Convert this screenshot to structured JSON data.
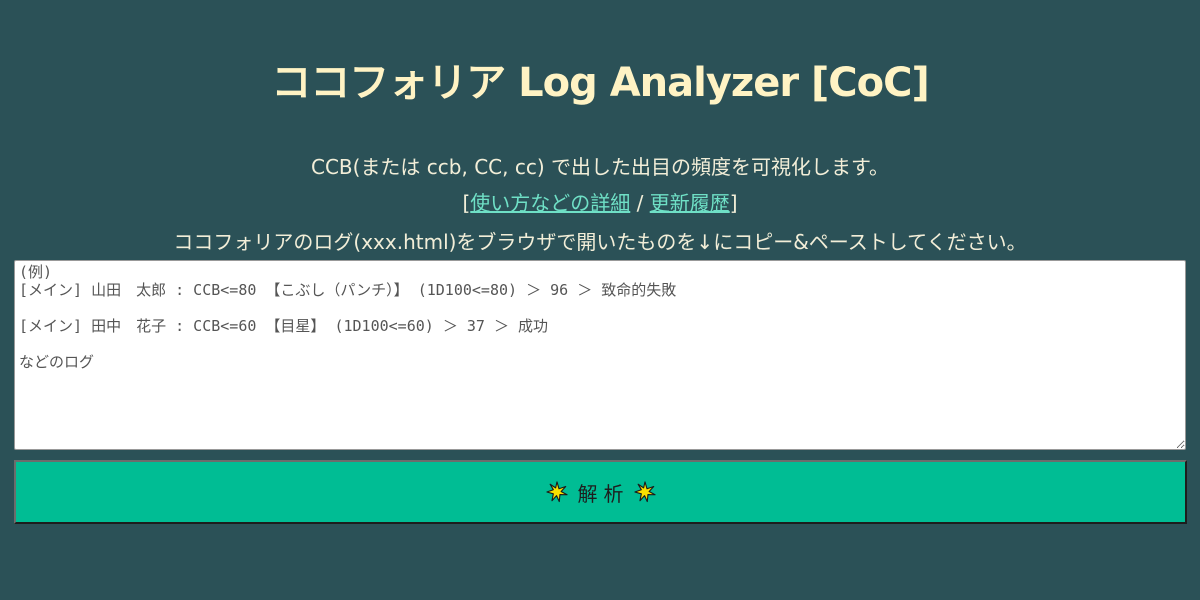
{
  "header": {
    "title": "ココフォリア Log Analyzer [CoC]"
  },
  "intro": {
    "line1": "CCB(または ccb, CC, cc) で出した出目の頻度を可視化します。",
    "bracket_open": "[",
    "link_usage": "使い方などの詳細",
    "separator": " / ",
    "link_history": "更新履歴",
    "bracket_close": "]",
    "line3": "ココフォリアのログ(xxx.html)をブラウザで開いたものを↓にコピー&ペーストしてください。"
  },
  "log_input": {
    "value": "",
    "placeholder": "(例)\n[メイン] 山田　太郎 : CCB<=80 【こぶし（パンチ）】 (1D100<=80) ＞ 96 ＞ 致命的失敗\n\n[メイン] 田中　花子 : CCB<=60 【目星】 (1D100<=60) ＞ 37 ＞ 成功\n\nなどのログ"
  },
  "analyze_button": {
    "label": "解析",
    "icon": "sparkle-icon"
  },
  "colors": {
    "background": "#2b5157",
    "title": "#fff3c4",
    "text": "#f2eed8",
    "link": "#6fe0c6",
    "button": "#00bd94"
  }
}
